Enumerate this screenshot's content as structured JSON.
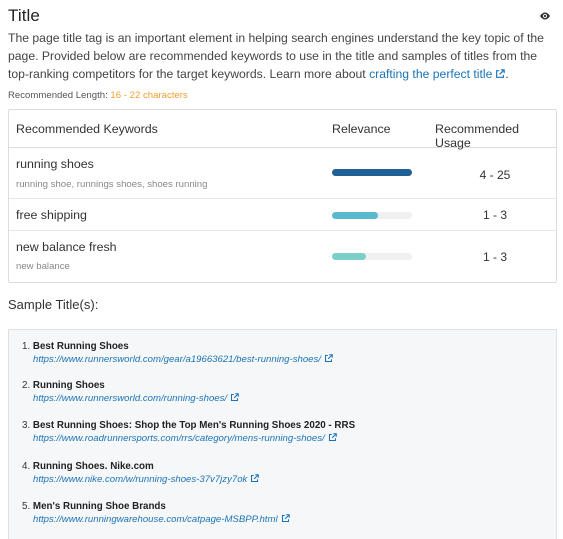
{
  "section": {
    "title": "Title",
    "description": "The page title tag is an important element in helping search engines understand the key topic of the page. Provided below are recommended keywords to use in the title and samples of titles from the top-ranking competitors for the target keywords. Learn more about",
    "learn_more_link": "crafting the perfect title",
    "recommended_length_label": "Recommended Length:",
    "recommended_length_value": "16 - 22 characters"
  },
  "keywords_table": {
    "headers": {
      "keyword": "Recommended Keywords",
      "relevance": "Relevance",
      "usage": "Recommended Usage"
    },
    "rows": [
      {
        "keyword": "running shoes",
        "variants": "running shoe, runnings shoes, shoes running",
        "relevance": 1.0,
        "color": "#1f5f93",
        "usage": "4 - 25"
      },
      {
        "keyword": "free shipping",
        "variants": "",
        "relevance": 0.57,
        "color": "#58b9d0",
        "usage": "1 - 3"
      },
      {
        "keyword": "new balance fresh",
        "variants": "new balance",
        "relevance": 0.42,
        "color": "#7ccfc9",
        "usage": "1 - 3"
      }
    ]
  },
  "samples": {
    "label": "Sample Title(s):",
    "items": [
      {
        "num": "1.",
        "title": "Best Running Shoes",
        "url": "https://www.runnersworld.com/gear/a19663621/best-running-shoes/"
      },
      {
        "num": "2.",
        "title": "Running Shoes",
        "url": "https://www.runnersworld.com/running-shoes/"
      },
      {
        "num": "3.",
        "title": "Best Running Shoes: Shop the Top Men's Running Shoes 2020 - RRS",
        "url": "https://www.roadrunnersports.com/rrs/category/mens-running-shoes/"
      },
      {
        "num": "4.",
        "title": "Running Shoes. Nike.com",
        "url": "https://www.nike.com/w/running-shoes-37v7jzy7ok"
      },
      {
        "num": "5.",
        "title": "Men's Running Shoe Brands",
        "url": "https://www.runningwarehouse.com/catpage-MSBPP.html"
      }
    ]
  },
  "icons": {
    "visibility": "eye-icon",
    "external_link": "external-link-icon"
  },
  "colors": {
    "link": "#1a73b8",
    "recommended_length": "#f0a030"
  }
}
